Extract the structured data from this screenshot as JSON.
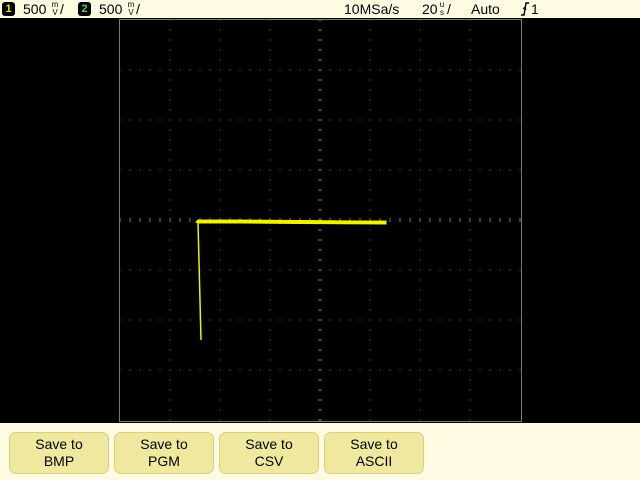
{
  "status": {
    "ch1": {
      "number": "1",
      "scale": "500",
      "unit_top": "m",
      "unit_bottom": "V",
      "color": "#f2e600"
    },
    "ch2": {
      "number": "2",
      "scale": "500",
      "unit_top": "m",
      "unit_bottom": "V",
      "color": "#00a000"
    },
    "sample_rate": "10MSa/s",
    "timebase": {
      "value": "20",
      "unit_top": "u",
      "unit_bottom": "s"
    },
    "trigger_mode": "Auto",
    "trigger_icon": "rising-edge-icon",
    "trigger_source": "1"
  },
  "trace": {
    "color": "#f2f200",
    "description_free": true
  },
  "softkeys": [
    {
      "line1": "Save to",
      "line2": "BMP"
    },
    {
      "line1": "Save to",
      "line2": "PGM"
    },
    {
      "line1": "Save to",
      "line2": "CSV"
    },
    {
      "line1": "Save to",
      "line2": "ASCII"
    }
  ],
  "colors": {
    "background": "#000000",
    "bar_background": "#fffbe3",
    "softkey_fill": "#efe9a0",
    "graticule": "#7a7a7a"
  }
}
